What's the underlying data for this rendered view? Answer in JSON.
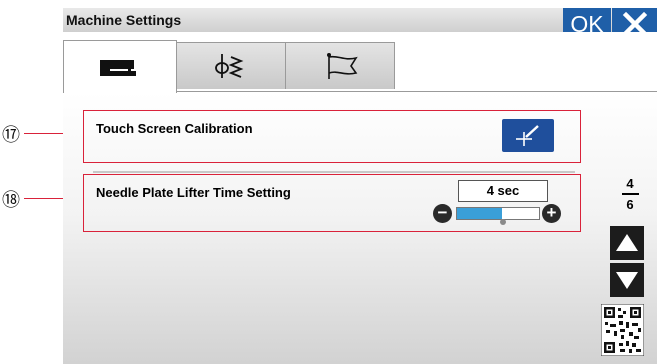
{
  "window": {
    "title": "Machine Settings",
    "ok_label": "OK"
  },
  "tabs": [
    {
      "icon": "sewing-machine-icon"
    },
    {
      "icon": "needle-stitch-icon"
    },
    {
      "icon": "flag-icon"
    }
  ],
  "settings": [
    {
      "callout": "⑰",
      "label": "Touch Screen Calibration",
      "button_icon": "calibration-crosshair-icon"
    },
    {
      "callout": "⑱",
      "label": "Needle Plate Lifter Time Setting",
      "value": "4 sec",
      "level_fraction": 0.55
    }
  ],
  "pager": {
    "current": "4",
    "total": "6"
  },
  "colors": {
    "accent_blue": "#1f5fa8",
    "highlight_red": "#d9223a",
    "slider_fill": "#3a9fd8"
  }
}
